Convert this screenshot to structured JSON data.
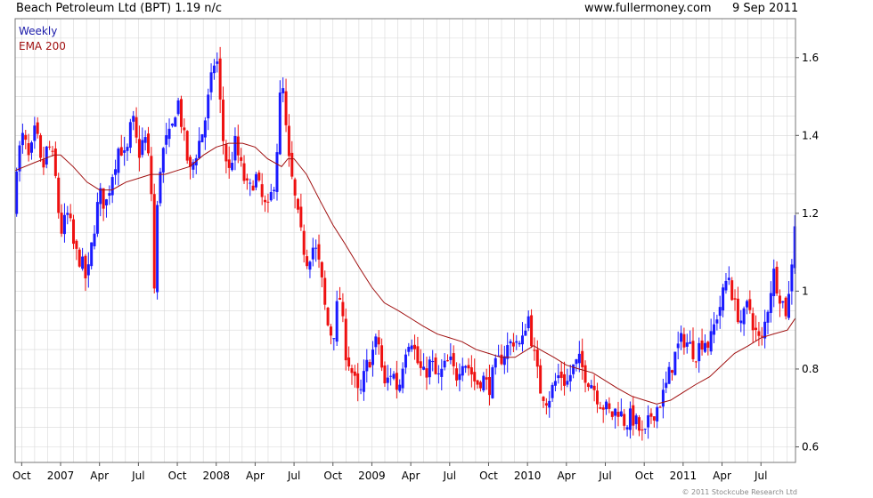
{
  "header": {
    "title": "Beach Petroleum Ltd (BPT) 1.19 n/c",
    "site": "www.fullermoney.com",
    "date": "9 Sep 2011"
  },
  "legend": {
    "weekly": "Weekly",
    "ema": "EMA 200"
  },
  "footer": {
    "copyright": "© 2011 Stockcube Research Ltd"
  },
  "colors": {
    "up": "#1a1aff",
    "down": "#ee1111",
    "ema": "#a01010",
    "grid": "#d8d8d8"
  },
  "chart_data": {
    "type": "candlestick",
    "title": "Beach Petroleum Ltd (BPT) 1.19 n/c",
    "ylim": [
      0.56,
      1.7
    ],
    "y_ticks": [
      0.6,
      0.8,
      1,
      1.2,
      1.4,
      1.6
    ],
    "x_range": [
      2006.708,
      2011.722
    ],
    "x_ticks": [
      {
        "label": "Oct",
        "t": 2006.75
      },
      {
        "label": "2007",
        "t": 2007.0
      },
      {
        "label": "Apr",
        "t": 2007.25
      },
      {
        "label": "Jul",
        "t": 2007.5
      },
      {
        "label": "Oct",
        "t": 2007.75
      },
      {
        "label": "2008",
        "t": 2008.0
      },
      {
        "label": "Apr",
        "t": 2008.25
      },
      {
        "label": "Jul",
        "t": 2008.5
      },
      {
        "label": "Oct",
        "t": 2008.75
      },
      {
        "label": "2009",
        "t": 2009.0
      },
      {
        "label": "Apr",
        "t": 2009.25
      },
      {
        "label": "Jul",
        "t": 2009.5
      },
      {
        "label": "Oct",
        "t": 2009.75
      },
      {
        "label": "2010",
        "t": 2010.0
      },
      {
        "label": "Apr",
        "t": 2010.25
      },
      {
        "label": "Jul",
        "t": 2010.5
      },
      {
        "label": "Oct",
        "t": 2010.75
      },
      {
        "label": "2011",
        "t": 2011.0
      },
      {
        "label": "Apr",
        "t": 2011.25
      },
      {
        "label": "Jul",
        "t": 2011.5
      }
    ],
    "close_path": [
      [
        2006.71,
        1.32
      ],
      [
        2006.76,
        1.4
      ],
      [
        2006.8,
        1.33
      ],
      [
        2006.84,
        1.42
      ],
      [
        2006.88,
        1.3
      ],
      [
        2006.92,
        1.38
      ],
      [
        2006.96,
        1.32
      ],
      [
        2007.0,
        1.15
      ],
      [
        2007.05,
        1.2
      ],
      [
        2007.09,
        1.1
      ],
      [
        2007.13,
        1.08
      ],
      [
        2007.17,
        1.02
      ],
      [
        2007.21,
        1.15
      ],
      [
        2007.25,
        1.25
      ],
      [
        2007.29,
        1.22
      ],
      [
        2007.33,
        1.3
      ],
      [
        2007.38,
        1.38
      ],
      [
        2007.42,
        1.33
      ],
      [
        2007.46,
        1.45
      ],
      [
        2007.5,
        1.35
      ],
      [
        2007.54,
        1.4
      ],
      [
        2007.58,
        1.3
      ],
      [
        2007.6,
        0.98
      ],
      [
        2007.63,
        1.3
      ],
      [
        2007.67,
        1.38
      ],
      [
        2007.71,
        1.4
      ],
      [
        2007.75,
        1.5
      ],
      [
        2007.79,
        1.4
      ],
      [
        2007.83,
        1.3
      ],
      [
        2007.88,
        1.37
      ],
      [
        2007.92,
        1.42
      ],
      [
        2007.96,
        1.52
      ],
      [
        2008.0,
        1.62
      ],
      [
        2008.04,
        1.4
      ],
      [
        2008.08,
        1.3
      ],
      [
        2008.12,
        1.38
      ],
      [
        2008.17,
        1.3
      ],
      [
        2008.21,
        1.25
      ],
      [
        2008.25,
        1.3
      ],
      [
        2008.29,
        1.24
      ],
      [
        2008.33,
        1.2
      ],
      [
        2008.38,
        1.3
      ],
      [
        2008.42,
        1.56
      ],
      [
        2008.46,
        1.35
      ],
      [
        2008.5,
        1.25
      ],
      [
        2008.54,
        1.15
      ],
      [
        2008.58,
        1.08
      ],
      [
        2008.63,
        1.12
      ],
      [
        2008.67,
        1.05
      ],
      [
        2008.71,
        0.92
      ],
      [
        2008.75,
        0.88
      ],
      [
        2008.79,
        1.0
      ],
      [
        2008.83,
        0.85
      ],
      [
        2008.88,
        0.78
      ],
      [
        2008.92,
        0.72
      ],
      [
        2008.96,
        0.8
      ],
      [
        2009.0,
        0.84
      ],
      [
        2009.04,
        0.88
      ],
      [
        2009.08,
        0.75
      ],
      [
        2009.13,
        0.8
      ],
      [
        2009.17,
        0.74
      ],
      [
        2009.21,
        0.85
      ],
      [
        2009.25,
        0.89
      ],
      [
        2009.29,
        0.82
      ],
      [
        2009.33,
        0.78
      ],
      [
        2009.38,
        0.82
      ],
      [
        2009.42,
        0.77
      ],
      [
        2009.46,
        0.8
      ],
      [
        2009.5,
        0.82
      ],
      [
        2009.54,
        0.78
      ],
      [
        2009.58,
        0.83
      ],
      [
        2009.63,
        0.8
      ],
      [
        2009.67,
        0.76
      ],
      [
        2009.71,
        0.78
      ],
      [
        2009.75,
        0.75
      ],
      [
        2009.79,
        0.8
      ],
      [
        2009.83,
        0.83
      ],
      [
        2009.88,
        0.86
      ],
      [
        2009.92,
        0.88
      ],
      [
        2009.96,
        0.85
      ],
      [
        2010.0,
        0.95
      ],
      [
        2010.04,
        0.84
      ],
      [
        2010.08,
        0.75
      ],
      [
        2010.13,
        0.72
      ],
      [
        2010.17,
        0.76
      ],
      [
        2010.21,
        0.79
      ],
      [
        2010.25,
        0.76
      ],
      [
        2010.29,
        0.8
      ],
      [
        2010.33,
        0.82
      ],
      [
        2010.38,
        0.78
      ],
      [
        2010.42,
        0.76
      ],
      [
        2010.46,
        0.72
      ],
      [
        2010.5,
        0.7
      ],
      [
        2010.54,
        0.68
      ],
      [
        2010.58,
        0.7
      ],
      [
        2010.63,
        0.66
      ],
      [
        2010.67,
        0.68
      ],
      [
        2010.71,
        0.65
      ],
      [
        2010.75,
        0.62
      ],
      [
        2010.79,
        0.68
      ],
      [
        2010.83,
        0.7
      ],
      [
        2010.88,
        0.74
      ],
      [
        2010.92,
        0.8
      ],
      [
        2010.96,
        0.85
      ],
      [
        2011.0,
        0.88
      ],
      [
        2011.04,
        0.86
      ],
      [
        2011.08,
        0.84
      ],
      [
        2011.13,
        0.88
      ],
      [
        2011.17,
        0.86
      ],
      [
        2011.21,
        0.93
      ],
      [
        2011.25,
        0.98
      ],
      [
        2011.29,
        1.05
      ],
      [
        2011.33,
        0.96
      ],
      [
        2011.38,
        0.92
      ],
      [
        2011.42,
        0.97
      ],
      [
        2011.46,
        0.9
      ],
      [
        2011.5,
        0.86
      ],
      [
        2011.54,
        0.95
      ],
      [
        2011.58,
        1.05
      ],
      [
        2011.63,
        0.98
      ],
      [
        2011.67,
        0.94
      ],
      [
        2011.72,
        1.19
      ]
    ],
    "ema_path": [
      [
        2006.71,
        1.31
      ],
      [
        2006.83,
        1.33
      ],
      [
        2006.96,
        1.35
      ],
      [
        2007.0,
        1.35
      ],
      [
        2007.08,
        1.32
      ],
      [
        2007.17,
        1.28
      ],
      [
        2007.25,
        1.26
      ],
      [
        2007.33,
        1.26
      ],
      [
        2007.42,
        1.28
      ],
      [
        2007.5,
        1.29
      ],
      [
        2007.58,
        1.3
      ],
      [
        2007.63,
        1.3
      ],
      [
        2007.67,
        1.3
      ],
      [
        2007.75,
        1.31
      ],
      [
        2007.83,
        1.32
      ],
      [
        2007.92,
        1.35
      ],
      [
        2008.0,
        1.37
      ],
      [
        2008.08,
        1.38
      ],
      [
        2008.17,
        1.38
      ],
      [
        2008.25,
        1.37
      ],
      [
        2008.33,
        1.34
      ],
      [
        2008.42,
        1.32
      ],
      [
        2008.46,
        1.34
      ],
      [
        2008.5,
        1.34
      ],
      [
        2008.58,
        1.3
      ],
      [
        2008.67,
        1.23
      ],
      [
        2008.75,
        1.17
      ],
      [
        2008.83,
        1.12
      ],
      [
        2008.92,
        1.06
      ],
      [
        2009.0,
        1.01
      ],
      [
        2009.08,
        0.97
      ],
      [
        2009.17,
        0.95
      ],
      [
        2009.25,
        0.93
      ],
      [
        2009.33,
        0.91
      ],
      [
        2009.42,
        0.89
      ],
      [
        2009.5,
        0.88
      ],
      [
        2009.58,
        0.87
      ],
      [
        2009.67,
        0.85
      ],
      [
        2009.75,
        0.84
      ],
      [
        2009.83,
        0.83
      ],
      [
        2009.92,
        0.83
      ],
      [
        2010.0,
        0.85
      ],
      [
        2010.04,
        0.86
      ],
      [
        2010.08,
        0.85
      ],
      [
        2010.17,
        0.83
      ],
      [
        2010.25,
        0.81
      ],
      [
        2010.33,
        0.8
      ],
      [
        2010.42,
        0.79
      ],
      [
        2010.5,
        0.77
      ],
      [
        2010.58,
        0.75
      ],
      [
        2010.67,
        0.73
      ],
      [
        2010.75,
        0.72
      ],
      [
        2010.83,
        0.71
      ],
      [
        2010.92,
        0.72
      ],
      [
        2011.0,
        0.74
      ],
      [
        2011.08,
        0.76
      ],
      [
        2011.17,
        0.78
      ],
      [
        2011.25,
        0.81
      ],
      [
        2011.33,
        0.84
      ],
      [
        2011.42,
        0.86
      ],
      [
        2011.5,
        0.88
      ],
      [
        2011.58,
        0.89
      ],
      [
        2011.67,
        0.9
      ],
      [
        2011.72,
        0.93
      ]
    ],
    "last_close": 1.19,
    "legend_position": "top-left",
    "grid": true
  }
}
